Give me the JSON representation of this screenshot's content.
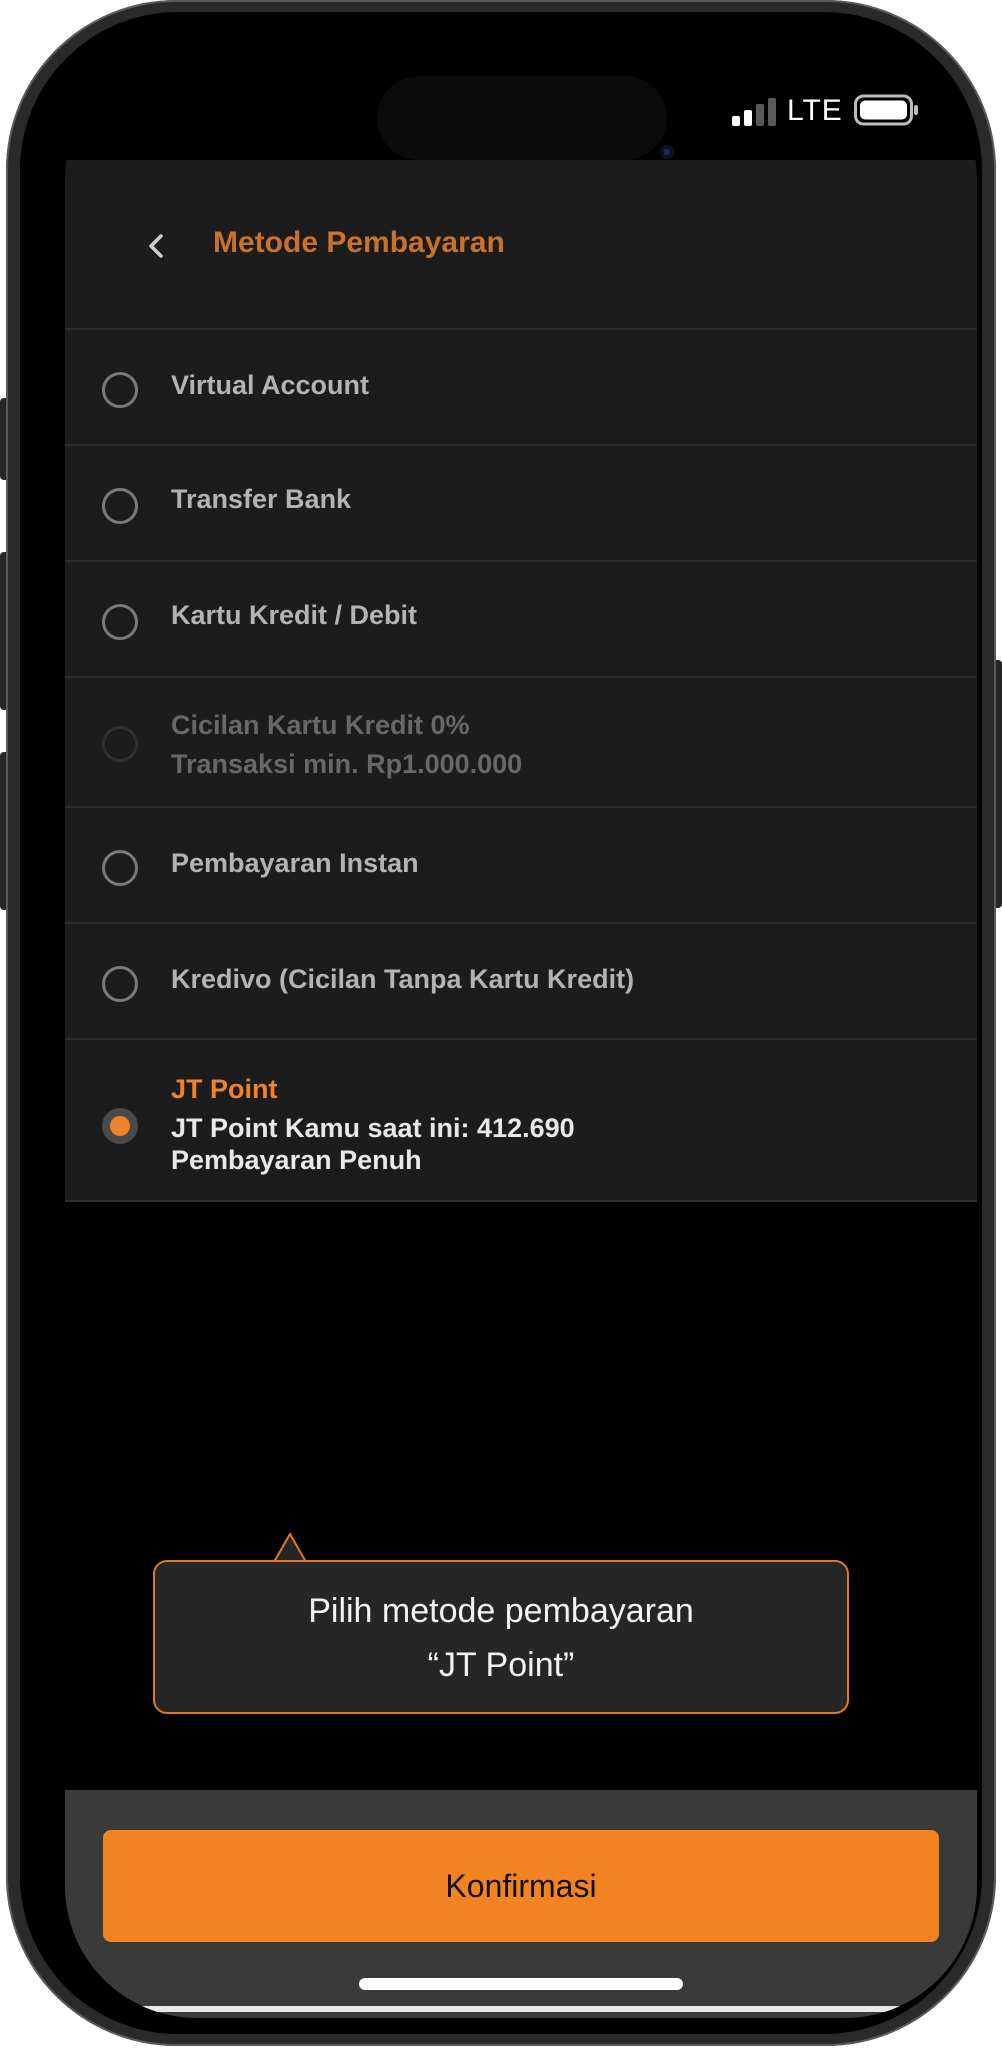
{
  "status_bar": {
    "network": "LTE",
    "signal_icon": "signal-bars-icon",
    "battery_icon": "battery-icon"
  },
  "header": {
    "back_icon": "chevron-left-icon",
    "title": "Metode Pembayaran"
  },
  "payment_methods": [
    {
      "label": "Virtual Account",
      "selected": false,
      "disabled": false
    },
    {
      "label": "Transfer Bank",
      "selected": false,
      "disabled": false
    },
    {
      "label": "Kartu Kredit / Debit",
      "selected": false,
      "disabled": false
    },
    {
      "label": "Cicilan Kartu Kredit 0%",
      "note": "Transaksi min. Rp1.000.000",
      "selected": false,
      "disabled": true
    },
    {
      "label": "Pembayaran Instan",
      "selected": false,
      "disabled": false
    },
    {
      "label": "Kredivo (Cicilan Tanpa Kartu Kredit)",
      "selected": false,
      "disabled": false
    },
    {
      "label": "JT Point",
      "balance_text": "JT Point Kamu saat ini: 412.690",
      "payment_type": "Pembayaran Penuh",
      "selected": true,
      "disabled": false
    }
  ],
  "tooltip": {
    "line1": "Pilih metode pembayaran",
    "line2": "“JT Point”"
  },
  "footer": {
    "confirm_label": "Konfirmasi"
  },
  "colors": {
    "accent": "#f28321",
    "title": "#c9722b",
    "panel": "#1c1c1c",
    "footer": "#3a3a3a"
  }
}
